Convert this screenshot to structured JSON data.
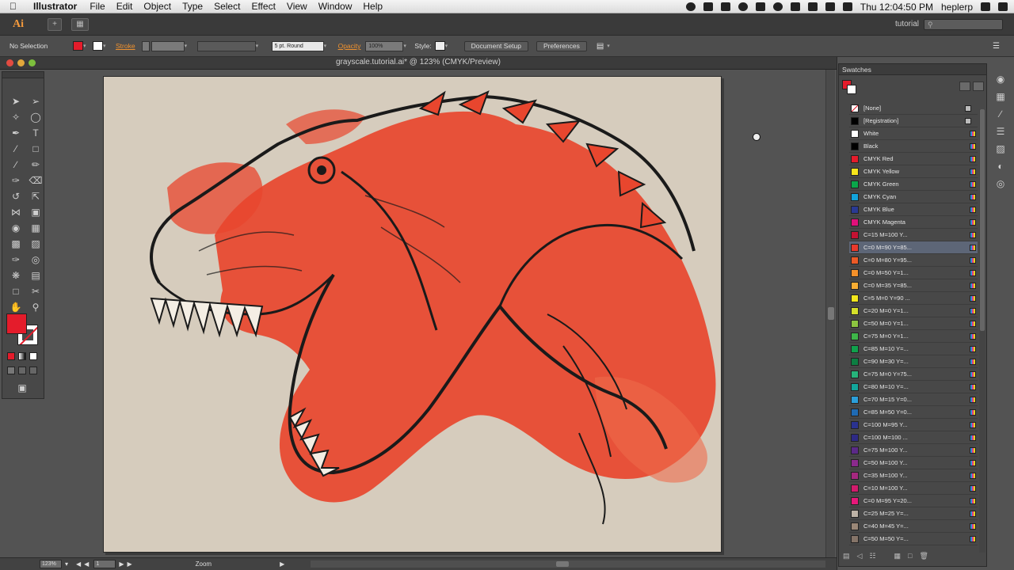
{
  "menubar": {
    "app_name": "Illustrator",
    "menus": [
      "File",
      "Edit",
      "Object",
      "Type",
      "Select",
      "Effect",
      "View",
      "Window",
      "Help"
    ],
    "clock": "Thu 12:04:50 PM",
    "user": "heplerp"
  },
  "appbar": {
    "logo": "Ai",
    "workspace": "tutorial",
    "search_placeholder": ""
  },
  "controlbar": {
    "selection_label": "No Selection",
    "stroke_label": "Stroke",
    "brush_value": "5 pt. Round",
    "opacity_label": "Opacity",
    "opacity_value": "100%",
    "style_label": "Style:",
    "doc_setup": "Document Setup",
    "preferences": "Preferences",
    "fill_color": "#e41c2b"
  },
  "document": {
    "tab_title": "grayscale.tutorial.ai* @ 123% (CMYK/Preview)"
  },
  "statusbar": {
    "zoom": "123%",
    "page": "1",
    "tool_name": "Zoom"
  },
  "swatches": {
    "panel_title": "Swatches",
    "items": [
      {
        "name": "[None]",
        "color": "#ffffff",
        "none": true
      },
      {
        "name": "[Registration]",
        "color": "#000000"
      },
      {
        "name": "White",
        "color": "#ffffff"
      },
      {
        "name": "Black",
        "color": "#000000"
      },
      {
        "name": "CMYK Red",
        "color": "#e41c2b"
      },
      {
        "name": "CMYK Yellow",
        "color": "#f7e51b"
      },
      {
        "name": "CMYK Green",
        "color": "#0aa64a"
      },
      {
        "name": "CMYK Cyan",
        "color": "#12a3da"
      },
      {
        "name": "CMYK Blue",
        "color": "#2a3a93"
      },
      {
        "name": "CMYK Magenta",
        "color": "#e0107a"
      },
      {
        "name": "C=15 M=100 Y...",
        "color": "#c41232"
      },
      {
        "name": "C=0 M=90 Y=85...",
        "color": "#e93a2c",
        "selected": true
      },
      {
        "name": "C=0 M=80 Y=95...",
        "color": "#ec5a27"
      },
      {
        "name": "C=0 M=50 Y=1...",
        "color": "#f5912a"
      },
      {
        "name": "C=0 M=35 Y=85...",
        "color": "#f8ad33"
      },
      {
        "name": "C=5 M=0 Y=90 ...",
        "color": "#f2e61c"
      },
      {
        "name": "C=20 M=0 Y=1...",
        "color": "#d4df2a"
      },
      {
        "name": "C=50 M=0 Y=1...",
        "color": "#8cc540"
      },
      {
        "name": "C=75 M=0 Y=1...",
        "color": "#3eb549"
      },
      {
        "name": "C=85 M=10 Y=...",
        "color": "#10a14c"
      },
      {
        "name": "C=90 M=30 Y=...",
        "color": "#0c7e42"
      },
      {
        "name": "C=75 M=0 Y=75...",
        "color": "#26b47b"
      },
      {
        "name": "C=80 M=10 Y=...",
        "color": "#13a69b"
      },
      {
        "name": "C=70 M=15 Y=0...",
        "color": "#2b9ed9"
      },
      {
        "name": "C=85 M=50 Y=0...",
        "color": "#1f6ab3"
      },
      {
        "name": "C=100 M=95 Y...",
        "color": "#2a3290"
      },
      {
        "name": "C=100 M=100 ...",
        "color": "#2e2a85"
      },
      {
        "name": "C=75 M=100 Y...",
        "color": "#5b2a88"
      },
      {
        "name": "C=50 M=100 Y...",
        "color": "#8b2a8d"
      },
      {
        "name": "C=35 M=100 Y...",
        "color": "#a5287f"
      },
      {
        "name": "C=10 M=100 Y...",
        "color": "#d01b6c"
      },
      {
        "name": "C=0 M=95 Y=20...",
        "color": "#e7187a"
      },
      {
        "name": "C=25 M=25 Y=...",
        "color": "#bdb2a6"
      },
      {
        "name": "C=40 M=45 Y=...",
        "color": "#9a8777"
      },
      {
        "name": "C=50 M=50 Y=...",
        "color": "#857468"
      }
    ]
  }
}
